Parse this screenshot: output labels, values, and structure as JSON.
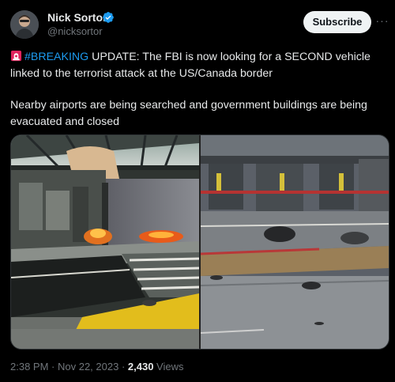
{
  "author": {
    "name": "Nick Sortor",
    "handle": "@nicksortor",
    "avatar_icon": "avatar-photo",
    "verified_icon": "verified-badge-icon",
    "verified_color": "#1d9bf0"
  },
  "actions": {
    "subscribe_label": "Subscribe",
    "more_label": "···"
  },
  "tweet": {
    "siren_icon": "rotating-light-icon",
    "hashtag": "#BREAKING",
    "line1_rest": " UPDATE: The FBI is now looking for a SECOND vehicle linked to the terrorist attack at the US/Canada border",
    "paragraph2": "Nearby airports are being searched and government buildings are being evacuated and closed"
  },
  "media": {
    "left_photo_icon": "explosion-scene-photo",
    "right_photo_icon": "border-checkpoint-debris-photo"
  },
  "meta": {
    "time": "2:38 PM",
    "separator1": " · ",
    "date": "Nov 22, 2023",
    "separator2": " · ",
    "views_count": "2,430",
    "views_label": " Views"
  },
  "colors": {
    "background": "#000000",
    "text": "#e7e9ea",
    "secondary": "#71767b",
    "accent": "#1d9bf0",
    "button_bg": "#eff3f4"
  }
}
